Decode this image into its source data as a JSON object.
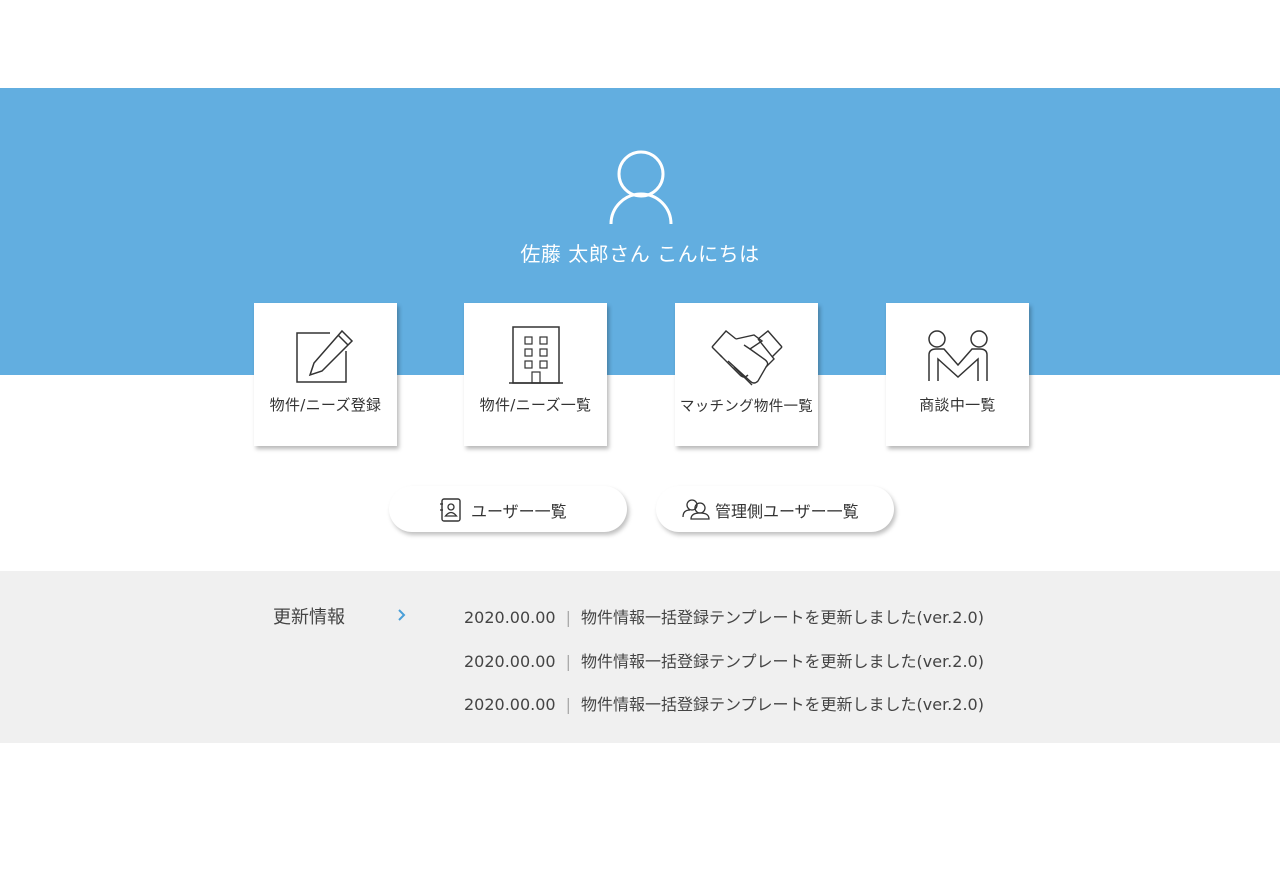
{
  "user": {
    "greeting": "佐藤 太郎さん こんにちは"
  },
  "menu_cards": [
    {
      "label": "物件/ニーズ登録",
      "icon": "edit-icon"
    },
    {
      "label": "物件/ニーズ一覧",
      "icon": "building-icon"
    },
    {
      "label": "マッチング物件一覧",
      "icon": "handshake-icon"
    },
    {
      "label": "商談中一覧",
      "icon": "meeting-icon"
    }
  ],
  "user_buttons": [
    {
      "label": "ユーザー一覧",
      "icon": "user-card-icon"
    },
    {
      "label": "管理側ユーザー一覧",
      "icon": "admin-users-icon"
    }
  ],
  "news": {
    "title": "更新情報",
    "items": [
      {
        "date": "2020.00.00",
        "separator": "|",
        "text": "物件情報一括登録テンプレートを更新しました(ver.2.0)"
      },
      {
        "date": "2020.00.00",
        "separator": "|",
        "text": "物件情報一括登録テンプレートを更新しました(ver.2.0)"
      },
      {
        "date": "2020.00.00",
        "separator": "|",
        "text": "物件情報一括登録テンプレートを更新しました(ver.2.0)"
      }
    ]
  },
  "colors": {
    "hero_bg": "#62aee0",
    "news_bg": "#f0f0f0",
    "accent_arrow": "#4a9fd8"
  }
}
